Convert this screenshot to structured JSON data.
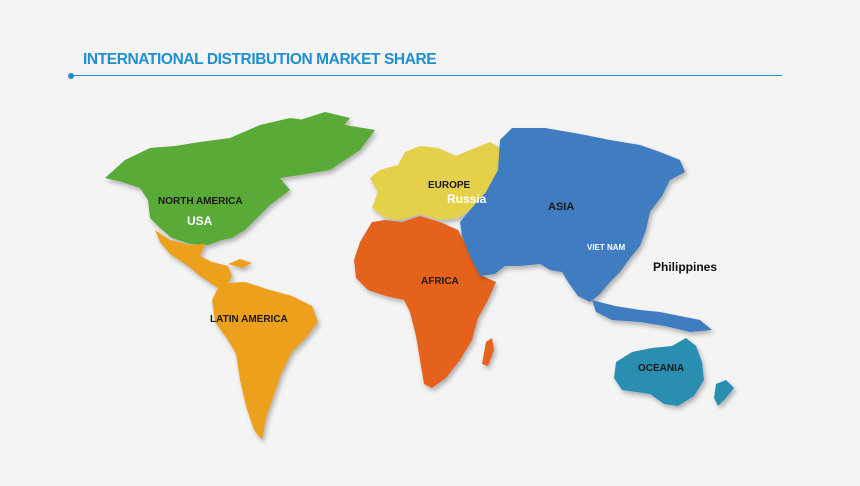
{
  "header": {
    "title": "INTERNATIONAL DISTRIBUTION MARKET SHARE"
  },
  "regions": {
    "north_america": {
      "label": "NORTH AMERICA",
      "color": "#5aaa37"
    },
    "latin_america": {
      "label": "LATIN AMERICA",
      "color": "#eca01e"
    },
    "europe": {
      "label": "EUROPE",
      "color": "#e4d04a"
    },
    "africa": {
      "label": "AFRICA",
      "color": "#e4621f"
    },
    "asia": {
      "label": "ASIA",
      "color": "#3f7cc0"
    },
    "oceania": {
      "label": "OCEANIA",
      "color": "#2a8eb0"
    }
  },
  "countries": {
    "usa": "USA",
    "russia": "Russia",
    "vietnam": "VIET NAM",
    "philippines": "Philippines"
  }
}
